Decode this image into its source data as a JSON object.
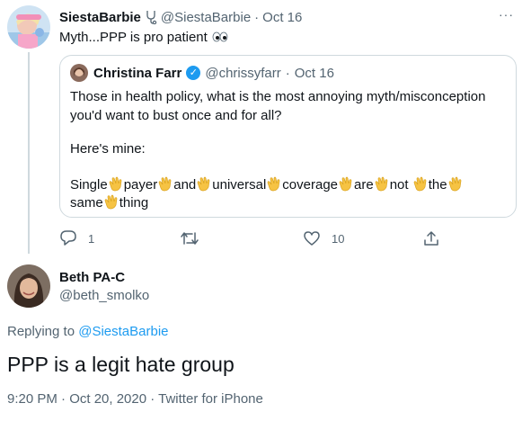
{
  "tweet1": {
    "display_name": "SiestaBarbie",
    "handle": "@SiestaBarbie",
    "separator": "·",
    "date": "Oct 16",
    "text": "Myth...PPP is pro patient",
    "more": "···",
    "quoted": {
      "display_name": "Christina Farr",
      "handle": "@chrissyfarr",
      "separator": "·",
      "date": "Oct 16",
      "line1": "Those in health policy, what is the most annoying myth/misconception",
      "line2": "you'd want to bust once and for all?",
      "line3": "Here's mine:",
      "words_row1": [
        "Single",
        "payer",
        "and",
        "universal",
        "coverage",
        "are",
        "not",
        "the"
      ],
      "words_row2": [
        "same",
        "thing"
      ]
    },
    "actions": {
      "reply_count": "1",
      "retweet_count": "",
      "like_count": "10"
    }
  },
  "tweet2": {
    "display_name": "Beth PA-C",
    "handle": "@beth_smolko",
    "replying_prefix": "Replying to",
    "replying_handle": "@SiestaBarbie",
    "text": "PPP is a legit hate group",
    "timestamp": "9:20 PM · Oct 20, 2020 · Twitter for iPhone"
  },
  "colors": {
    "accent": "#1d9bf0",
    "muted": "#536471",
    "border": "#cfd9de",
    "clap": "#f6c343"
  }
}
